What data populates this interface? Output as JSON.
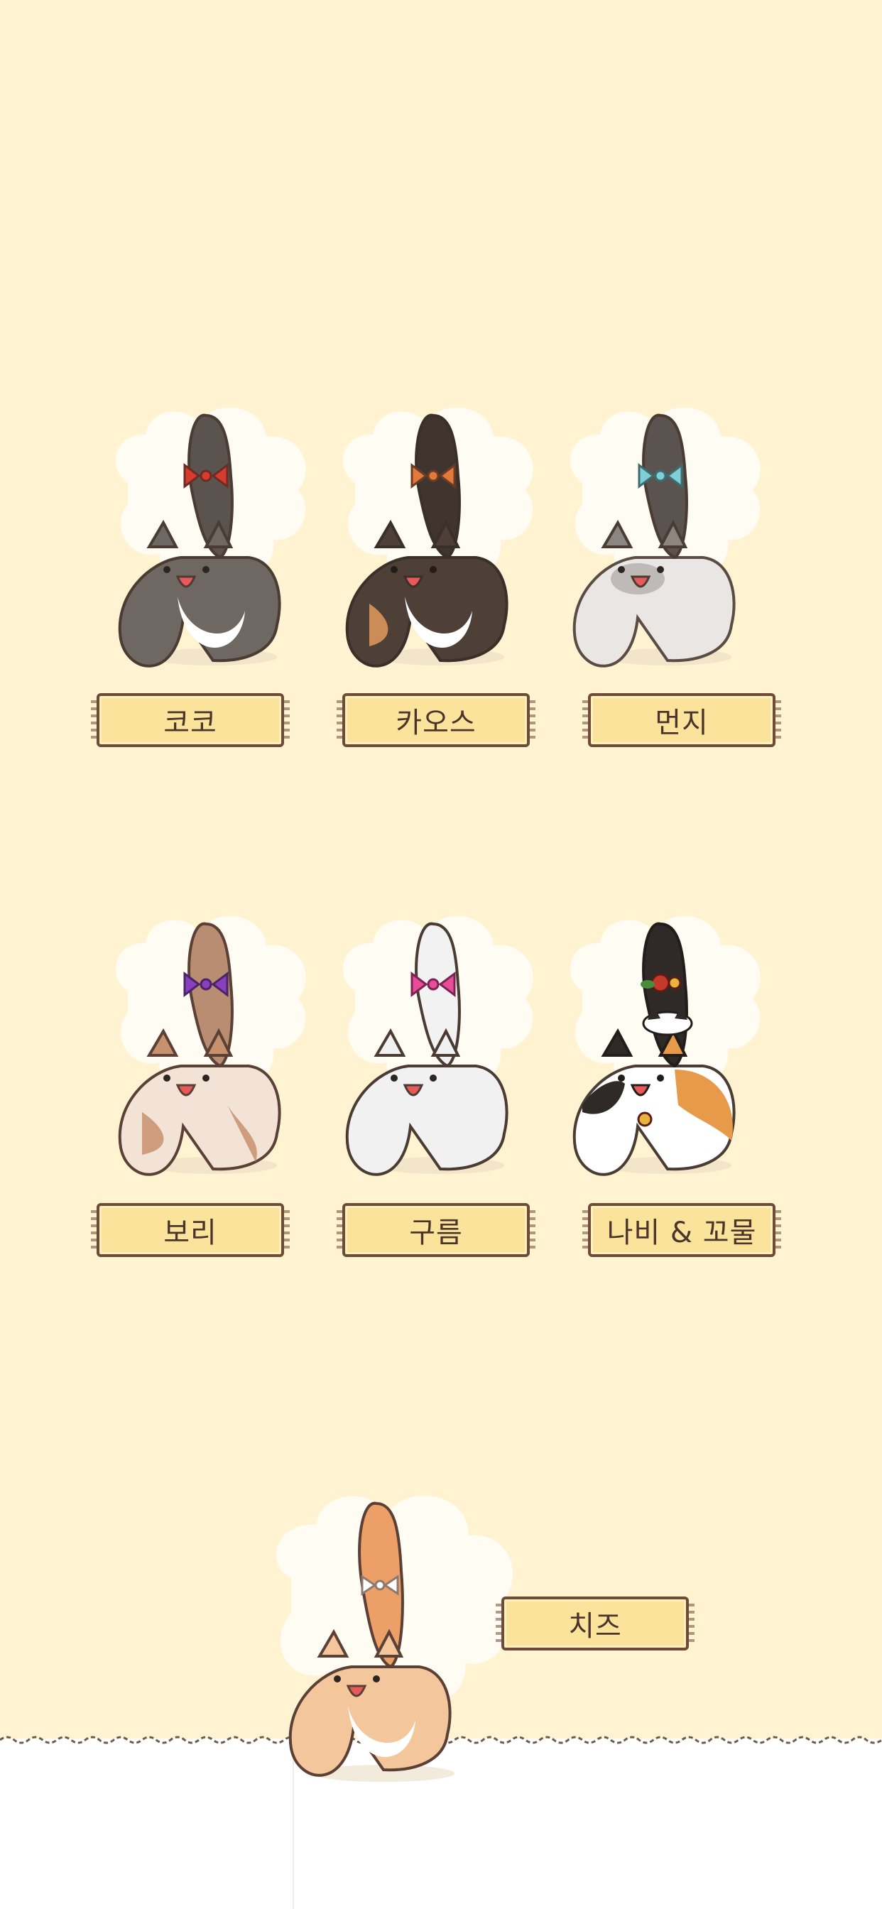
{
  "colors": {
    "background": "#fff3d2",
    "plate_fill": "#fbe39c",
    "plate_border": "#6e4b36",
    "plate_text": "#4b352a",
    "floor": "#ffffff"
  },
  "cats": [
    {
      "id": "coco",
      "name": "코코",
      "coat": "#6f6862",
      "belly": "#ffffff",
      "tail": "#5a534e",
      "ribbon": "#d93a2e",
      "ribbon_icon": "bow-icon"
    },
    {
      "id": "chaos",
      "name": "카오스",
      "coat": "#4e3f37",
      "belly": "#ffffff",
      "tail": "#3f342e",
      "ribbon": "#e37a3c",
      "ribbon_icon": "bow-icon"
    },
    {
      "id": "meonji",
      "name": "먼지",
      "coat": "#e9e6e3",
      "belly": "#ffffff",
      "tail": "#5b5350",
      "ribbon": "#7fd0d6",
      "ribbon_icon": "bow-icon"
    },
    {
      "id": "bori",
      "name": "보리",
      "coat": "#f3e3d6",
      "belly": "#ffffff",
      "tail": "#b98d72",
      "ribbon": "#8a3fbf",
      "ribbon_icon": "bow-icon"
    },
    {
      "id": "gureum",
      "name": "구름",
      "coat": "#f1f1f1",
      "belly": "#ffffff",
      "tail": "#f2f2f2",
      "ribbon": "#e84d9a",
      "ribbon_icon": "bow-icon"
    },
    {
      "id": "nabi",
      "name": "나비 & 꼬물",
      "coat": "#ffffff",
      "belly": "#ffffff",
      "tail": "#2f2a27",
      "ribbon": "#c33a2b",
      "ribbon_icon": "flower-bell-icon"
    },
    {
      "id": "cheese",
      "name": "치즈",
      "coat": "#f3c79b",
      "belly": "#ffffff",
      "tail": "#ec9f67",
      "ribbon": "#ffffff",
      "ribbon_icon": "bow-icon"
    }
  ]
}
